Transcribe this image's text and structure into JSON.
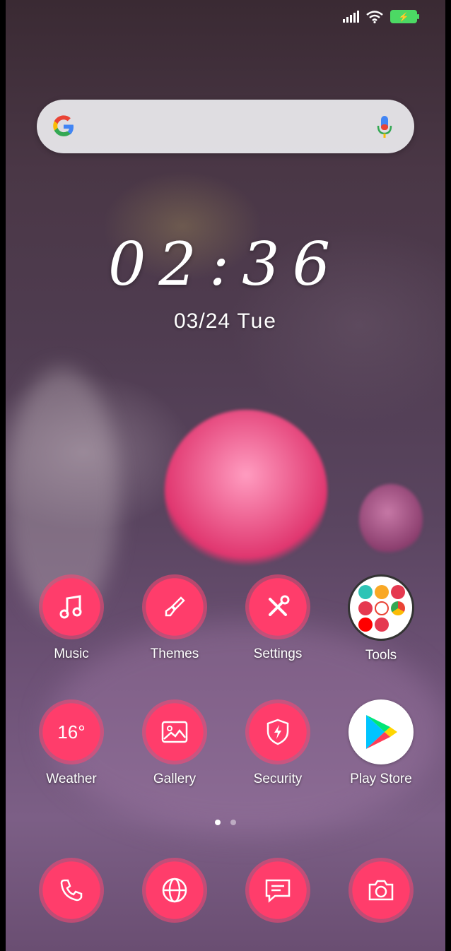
{
  "status_bar": {
    "icons": [
      "signal-icon",
      "wifi-icon",
      "battery-charging-icon"
    ],
    "battery_color": "#4cd964"
  },
  "search": {
    "logo": "google-logo",
    "mic_icon": "microphone-icon"
  },
  "clock": {
    "time": "02:36",
    "date": "03/24",
    "day": "Tue"
  },
  "apps_row1": [
    {
      "label": "Music",
      "icon": "music-note-icon"
    },
    {
      "label": "Themes",
      "icon": "paintbrush-icon"
    },
    {
      "label": "Settings",
      "icon": "tools-icon"
    },
    {
      "label": "Tools",
      "icon": "folder-icon"
    }
  ],
  "apps_row2": [
    {
      "label": "Weather",
      "value": "16°",
      "icon": "weather-icon"
    },
    {
      "label": "Gallery",
      "icon": "image-icon"
    },
    {
      "label": "Security",
      "icon": "shield-bolt-icon"
    },
    {
      "label": "Play Store",
      "icon": "play-store-icon"
    }
  ],
  "dock": [
    {
      "icon": "phone-icon"
    },
    {
      "icon": "globe-icon"
    },
    {
      "icon": "message-icon"
    },
    {
      "icon": "camera-icon"
    }
  ],
  "page_indicator": {
    "pages": 2,
    "current": 1
  },
  "accent_color": "#ff3d6b"
}
